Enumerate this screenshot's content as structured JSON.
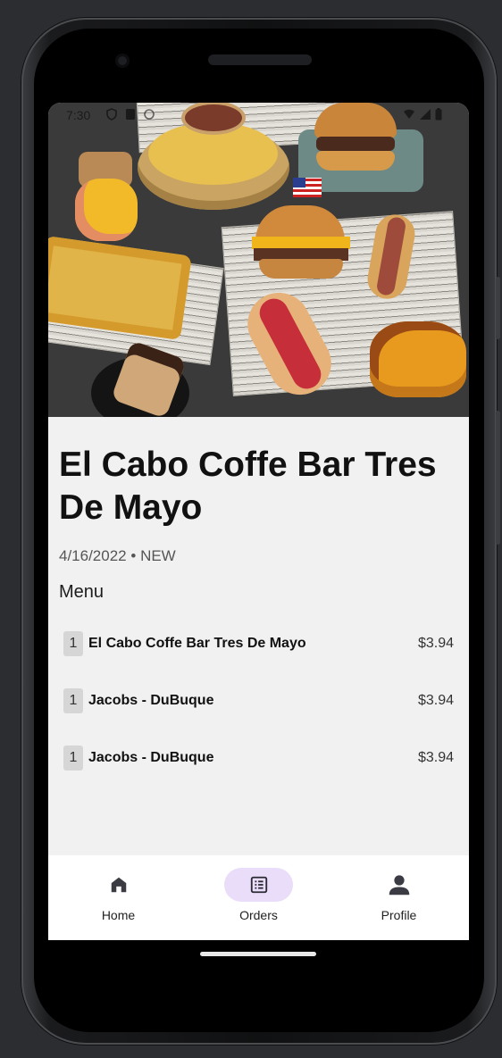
{
  "status_bar": {
    "time": "7:30"
  },
  "restaurant": {
    "name": "El Cabo Coffe Bar Tres De Mayo",
    "date": "4/16/2022",
    "separator": "•",
    "status": "NEW"
  },
  "menu": {
    "heading": "Menu",
    "items": [
      {
        "qty": "1",
        "name": "El Cabo Coffe Bar Tres De Mayo",
        "price": "$3.94"
      },
      {
        "qty": "1",
        "name": "Jacobs - DuBuque",
        "price": "$3.94"
      },
      {
        "qty": "1",
        "name": "Jacobs - DuBuque",
        "price": "$3.94"
      }
    ]
  },
  "bottom_nav": {
    "items": [
      {
        "label": "Home",
        "icon": "home-icon",
        "active": false
      },
      {
        "label": "Orders",
        "icon": "orders-list-icon",
        "active": true
      },
      {
        "label": "Profile",
        "icon": "person-icon",
        "active": false
      }
    ]
  },
  "colors": {
    "active_nav_pill": "#e9ddf9",
    "background": "#f1f1f1",
    "nav_background": "#ffffff"
  }
}
